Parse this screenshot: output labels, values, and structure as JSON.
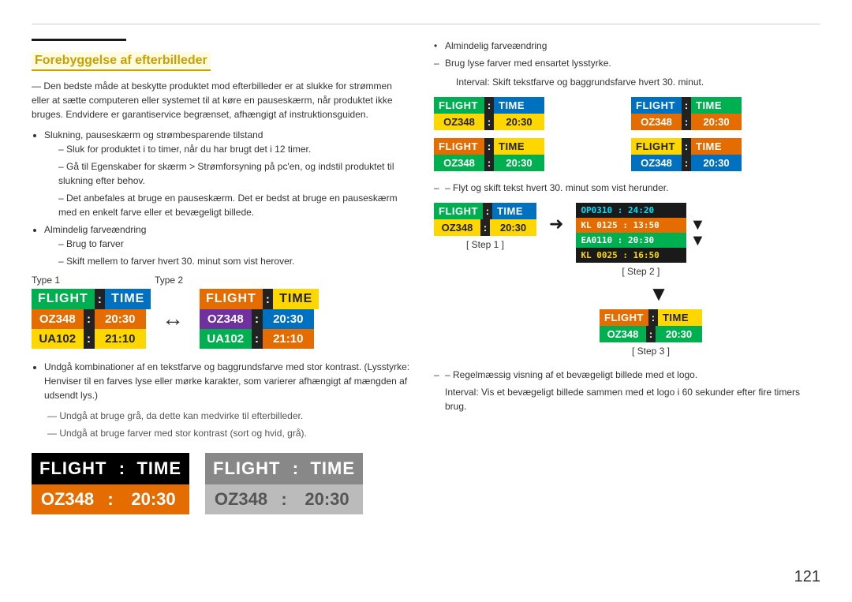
{
  "page": {
    "number": "121"
  },
  "top_rule": true,
  "section_rule": true,
  "left": {
    "section_title": "Forebyggelse af efterbilleder",
    "intro_text": "— Den bedste måde at beskytte produktet mod efterbilleder er at slukke for strømmen eller at sætte computeren eller systemet til at køre en pauseskærm, når produktet ikke bruges. Endvidere er garantiservice begrænset, afhængigt af instruktionsguiden.",
    "bullets": [
      {
        "text": "Slukning, pauseskærm og strømbesparende tilstand",
        "sub": [
          "Sluk for produktet i to timer, når du har brugt det i 12 timer.",
          "Gå til Egenskaber for skærm > Strømforsyning på pc'en, og indstil produktet til slukning efter behov.",
          "Det anbefales at bruge en pauseskærm. Det er bedst at bruge en pauseskærm med en enkelt farve eller et bevægeligt billede."
        ]
      },
      {
        "text": "Almindelig farveændring",
        "sub": [
          "Brug to farver",
          "Skift mellem to farver hvert 30. minut som vist herover."
        ]
      }
    ],
    "type_labels": [
      "Type 1",
      "Type 2"
    ],
    "panel1": {
      "header": [
        "FLIGHT",
        "TIME"
      ],
      "rows": [
        {
          "left": "OZ348",
          "right": "20:30"
        },
        {
          "left": "UA102",
          "right": "21:10"
        }
      ],
      "colors": {
        "flight_bg": "#00b050",
        "time_bg": "#0070c0",
        "row1_left_bg": "#e46c00",
        "row1_right_bg": "#e46c00",
        "row2_left_bg": "#ffd700",
        "row2_right_bg": "#ffd700"
      }
    },
    "panel2": {
      "header": [
        "FLIGHT",
        "TIME"
      ],
      "rows": [
        {
          "left": "OZ348",
          "right": "20:30"
        },
        {
          "left": "UA102",
          "right": "21:10"
        }
      ],
      "colors": {
        "flight_bg": "#e46c00",
        "time_bg": "#ffd700",
        "row1_left_bg": "#7030a0",
        "row1_right_bg": "#0070c0",
        "row2_left_bg": "#00b050",
        "row2_right_bg": "#e46c00"
      }
    },
    "avoid_bullets": [
      "Undgå kombinationer af en tekstfarve og baggrundsfarve med stor kontrast. (Lysstyrke: Henviser til en farves lyse eller mørke karakter, som varierer afhængigt af mængden af udsendt lys.)",
      "Undgå at bruge grå, da dette kan medvirke til efterbilleder.",
      "Undgå at bruge farver med stor kontrast (sort og hvid, grå)."
    ],
    "bottom_panels": [
      {
        "id": "black_bg",
        "header": [
          "FLIGHT",
          "TIME"
        ],
        "row": {
          "left": "OZ348",
          "right": "20:30"
        },
        "header_flight_bg": "#000",
        "header_time_bg": "#000",
        "row_left_bg": "#e46c00",
        "row_right_bg": "#e46c00"
      },
      {
        "id": "gray_bg",
        "header": [
          "FLIGHT",
          "TIME"
        ],
        "row": {
          "left": "OZ348",
          "right": "20:30"
        },
        "header_flight_bg": "#888",
        "header_time_bg": "#888",
        "row_left_bg": "#aaa",
        "row_right_bg": "#aaa"
      }
    ]
  },
  "right": {
    "bullet_top": "Almindelig farveændring",
    "sub_bullets": [
      "Brug lyse farver med ensartet lysstyrke.",
      "Interval: Skift tekstfarve og baggrundsfarve hvert 30. minut."
    ],
    "color_panels": [
      {
        "id": "rp1",
        "header": [
          "FLIGHT",
          "TIME"
        ],
        "row": {
          "left": "OZ348",
          "right": "20:30"
        },
        "h_flight_bg": "#00b050",
        "h_time_bg": "#0070c0",
        "r_left_bg": "#ffd700",
        "r_right_bg": "#ffd700",
        "r_left_color": "#222",
        "r_right_color": "#222"
      },
      {
        "id": "rp2",
        "header": [
          "FLIGHT",
          "TIME"
        ],
        "row": {
          "left": "OZ348",
          "right": "20:30"
        },
        "h_flight_bg": "#0070c0",
        "h_time_bg": "#00b050",
        "r_left_bg": "#e46c00",
        "r_right_bg": "#e46c00",
        "r_left_color": "#fff",
        "r_right_color": "#fff"
      },
      {
        "id": "rp3",
        "header": [
          "FLIGHT",
          "TIME"
        ],
        "row": {
          "left": "OZ348",
          "right": "20:30"
        },
        "h_flight_bg": "#e46c00",
        "h_time_bg": "#ffd700",
        "r_left_bg": "#00b050",
        "r_right_bg": "#00b050",
        "r_left_color": "#fff",
        "r_right_color": "#fff"
      },
      {
        "id": "rp4",
        "header": [
          "FLIGHT",
          "TIME"
        ],
        "row": {
          "left": "OZ348",
          "right": "20:30"
        },
        "h_flight_bg": "#ffd700",
        "h_time_bg": "#e46c00",
        "r_left_bg": "#0070c0",
        "r_right_bg": "#0070c0",
        "r_left_color": "#fff",
        "r_right_color": "#fff"
      }
    ],
    "step_label": "– Flyt og skift tekst hvert 30. minut som vist herunder.",
    "step1_label": "[ Step 1 ]",
    "step2_label": "[ Step 2 ]",
    "step3_label": "[ Step 3 ]",
    "step1_panel": {
      "header": [
        "FLIGHT",
        "TIME"
      ],
      "row": {
        "left": "OZ348",
        "right": "20:30"
      },
      "h_flight_bg": "#00b050",
      "h_time_bg": "#0070c0",
      "r_left_bg": "#ffd700",
      "r_right_bg": "#ffd700"
    },
    "step2_rows": [
      {
        "text": "OP0310 : 24:20",
        "bg": "#222",
        "color": "#00e0ff"
      },
      {
        "text": "KL 0125 : 13:50",
        "bg": "#e46c00",
        "color": "#fff"
      },
      {
        "text": "EA0110 : 20:30",
        "bg": "#00b050",
        "color": "#fff"
      },
      {
        "text": "KL 0025 : 16:50",
        "bg": "#222",
        "color": "#ffd700"
      }
    ],
    "step3_panel": {
      "header": [
        "FLIGHT",
        "TIME"
      ],
      "row": {
        "left": "OZ348",
        "right": "20:30"
      },
      "h_flight_bg": "#e46c00",
      "h_time_bg": "#ffd700",
      "r_left_bg": "#00b050",
      "r_right_bg": "#00b050"
    },
    "regular_text": "– Regelmæssig visning af et bevægeligt billede med et logo.",
    "regular_sub": "Interval: Vis et bevægeligt billede sammen med et logo i 60 sekunder efter fire timers brug."
  }
}
